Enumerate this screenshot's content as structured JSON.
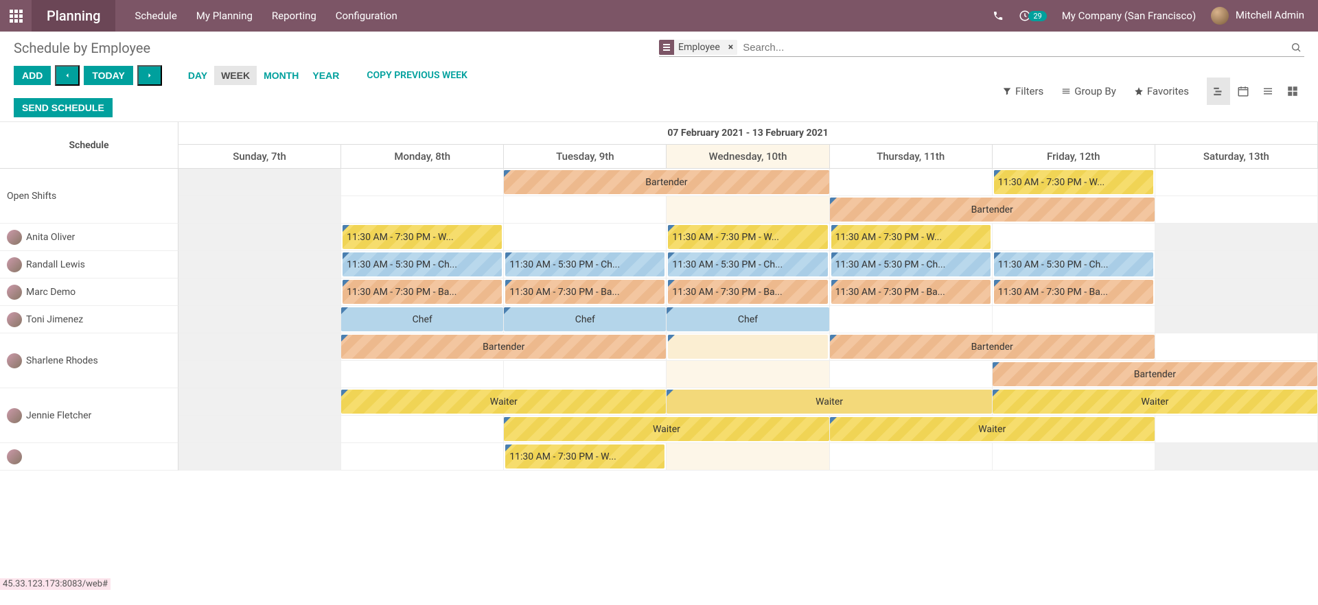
{
  "nav": {
    "app": "Planning",
    "menu": [
      "Schedule",
      "My Planning",
      "Reporting",
      "Configuration"
    ],
    "notif_count": "29",
    "company": "My Company (San Francisco)",
    "user": "Mitchell Admin"
  },
  "cp": {
    "title": "Schedule by Employee",
    "facet_label": "Employee",
    "search_placeholder": "Search...",
    "add": "ADD",
    "today": "TODAY",
    "send": "SEND SCHEDULE",
    "scales": {
      "day": "DAY",
      "week": "WEEK",
      "month": "MONTH",
      "year": "YEAR"
    },
    "copy": "COPY PREVIOUS WEEK",
    "filters": "Filters",
    "groupby": "Group By",
    "favorites": "Favorites"
  },
  "gantt": {
    "row_header": "Schedule",
    "range": "07 February 2021 - 13 February 2021",
    "days": [
      "Sunday, 7th",
      "Monday, 8th",
      "Tuesday, 9th",
      "Wednesday, 10th",
      "Thursday, 11th",
      "Friday, 12th",
      "Saturday, 13th"
    ],
    "today_index": 3,
    "rows": [
      {
        "label": "Open Shifts",
        "avatar": false,
        "subrows": [
          [
            null,
            null,
            {
              "text": "Bartender",
              "role": "bartender",
              "span": 2,
              "center": true
            },
            "skip",
            null,
            {
              "text": "11:30 AM - 7:30 PM - W...",
              "role": "waiter"
            },
            null
          ],
          [
            null,
            null,
            null,
            null,
            {
              "text": "Bartender",
              "role": "bartender",
              "span": 2,
              "center": true
            },
            "skip",
            null
          ]
        ]
      },
      {
        "label": "Anita Oliver",
        "avatar": true,
        "subrows": [
          [
            null,
            {
              "text": "11:30 AM - 7:30 PM - W...",
              "role": "waiter"
            },
            null,
            {
              "text": "11:30 AM - 7:30 PM - W...",
              "role": "waiter"
            },
            {
              "text": "11:30 AM - 7:30 PM - W...",
              "role": "waiter"
            },
            null,
            null
          ]
        ]
      },
      {
        "label": "Randall Lewis",
        "avatar": true,
        "subrows": [
          [
            null,
            {
              "text": "11:30 AM - 5:30 PM - Ch...",
              "role": "chef"
            },
            {
              "text": "11:30 AM - 5:30 PM - Ch...",
              "role": "chef"
            },
            {
              "text": "11:30 AM - 5:30 PM - Ch...",
              "role": "chef"
            },
            {
              "text": "11:30 AM - 5:30 PM - Ch...",
              "role": "chef"
            },
            {
              "text": "11:30 AM - 5:30 PM - Ch...",
              "role": "chef"
            },
            null
          ]
        ]
      },
      {
        "label": "Marc Demo",
        "avatar": true,
        "subrows": [
          [
            null,
            {
              "text": "11:30 AM - 7:30 PM - Ba...",
              "role": "bartender"
            },
            {
              "text": "11:30 AM - 7:30 PM - Ba...",
              "role": "bartender"
            },
            {
              "text": "11:30 AM - 7:30 PM - Ba...",
              "role": "bartender"
            },
            {
              "text": "11:30 AM - 7:30 PM - Ba...",
              "role": "bartender"
            },
            {
              "text": "11:30 AM - 7:30 PM - Ba...",
              "role": "bartender"
            },
            null
          ]
        ]
      },
      {
        "label": "Toni Jimenez",
        "avatar": true,
        "subrows": [
          [
            null,
            {
              "text": "Chef",
              "role": "chef-solid",
              "center": true
            },
            {
              "text": "Chef",
              "role": "chef-solid",
              "center": true
            },
            {
              "text": "Chef",
              "role": "chef-solid",
              "center": true
            },
            null,
            null,
            null
          ]
        ]
      },
      {
        "label": "Sharlene Rhodes",
        "avatar": true,
        "subrows": [
          [
            null,
            {
              "text": "Bartender",
              "role": "bartender",
              "span": 2,
              "center": true
            },
            "skip",
            {
              "text": "",
              "role": "empty-today"
            },
            {
              "text": "Bartender",
              "role": "bartender",
              "span": 2,
              "center": true
            },
            "skip",
            null
          ],
          [
            null,
            null,
            null,
            null,
            null,
            {
              "text": "Bartender",
              "role": "bartender",
              "span": 2,
              "center": true
            },
            "skip"
          ]
        ]
      },
      {
        "label": "Jennie Fletcher",
        "avatar": true,
        "subrows": [
          [
            null,
            {
              "text": "Waiter",
              "role": "waiter",
              "span": 2,
              "center": true
            },
            "skip",
            {
              "text": "Waiter",
              "role": "waiter-solid",
              "span": 2,
              "center": true
            },
            "skip",
            {
              "text": "Waiter",
              "role": "waiter",
              "span": 2,
              "center": true
            },
            "skip"
          ],
          [
            null,
            null,
            {
              "text": "Waiter",
              "role": "waiter",
              "span": 2,
              "center": true
            },
            "skip",
            {
              "text": "Waiter",
              "role": "waiter",
              "span": 2,
              "center": true
            },
            "skip",
            null
          ]
        ]
      },
      {
        "label": "",
        "avatar": true,
        "subrows": [
          [
            null,
            null,
            {
              "text": "11:30 AM - 7:30 PM - W...",
              "role": "waiter"
            },
            null,
            null,
            null,
            null
          ]
        ]
      }
    ]
  },
  "status_url": "45.33.123.173:8083/web#"
}
